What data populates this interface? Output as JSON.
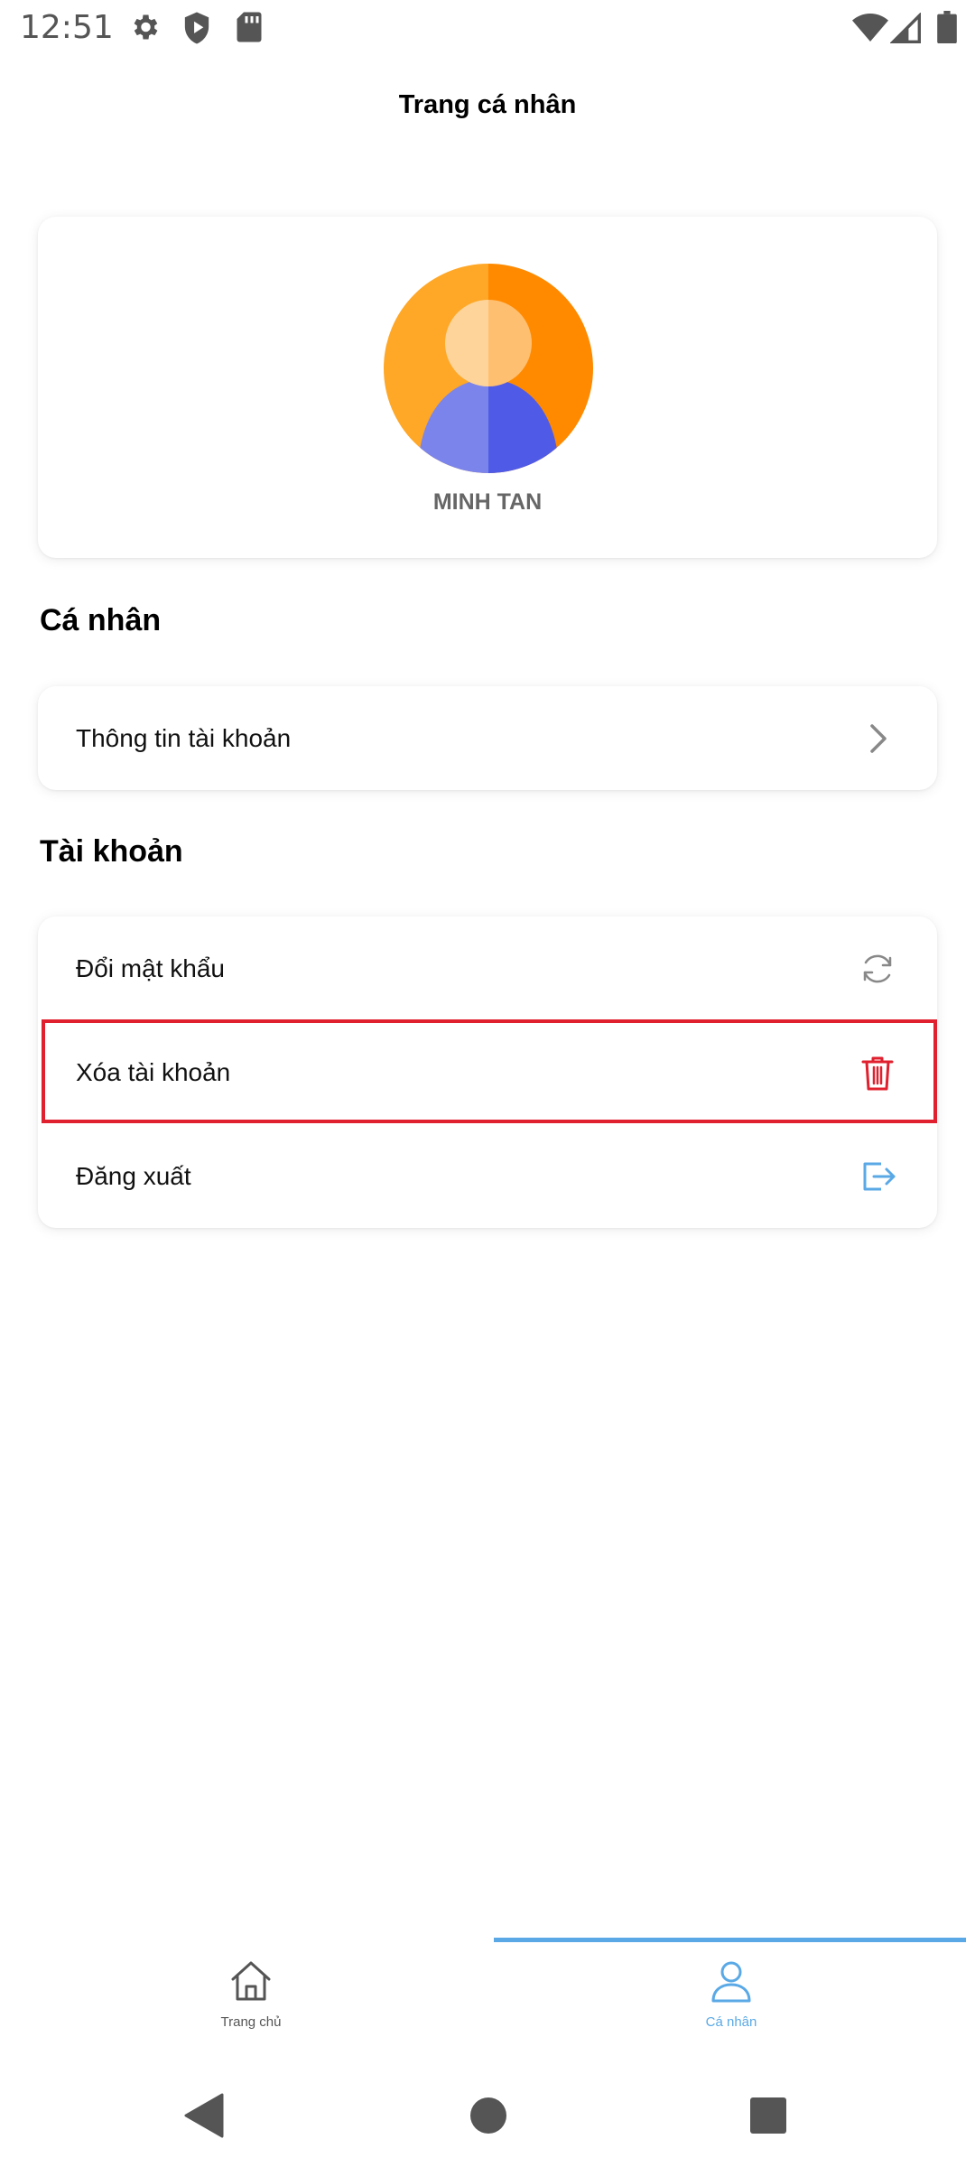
{
  "status_bar": {
    "time": "12:51",
    "icons": [
      "gear-icon",
      "shield-play-icon",
      "sd-card-icon",
      "wifi-icon",
      "cellular-signal-icon",
      "battery-icon"
    ]
  },
  "header": {
    "title": "Trang cá nhân"
  },
  "profile": {
    "name": "MINH TAN"
  },
  "sections": {
    "personal": {
      "heading": "Cá nhân",
      "items": [
        {
          "label": "Thông tin tài khoản",
          "icon": "chevron-right-icon"
        }
      ]
    },
    "account": {
      "heading": "Tài khoản",
      "items": [
        {
          "label": "Đổi mật khẩu",
          "icon": "refresh-icon"
        },
        {
          "label": "Xóa tài khoản",
          "icon": "trash-icon"
        },
        {
          "label": "Đăng xuất",
          "icon": "logout-icon"
        }
      ]
    }
  },
  "tabs": [
    {
      "label": "Trang chủ",
      "icon": "home-icon",
      "active": false
    },
    {
      "label": "Cá nhân",
      "icon": "user-icon",
      "active": true
    }
  ],
  "colors": {
    "accent": "#5aa9e6",
    "danger": "#e0202e",
    "inactive_tab": "#555555",
    "avatar_orange_light": "#ffa726",
    "avatar_orange_dark": "#ff8a00",
    "avatar_body_light": "#7b84ea",
    "avatar_body_dark": "#4f5be6"
  },
  "nav_bar": [
    "back-icon",
    "home-circle-icon",
    "recents-icon"
  ]
}
